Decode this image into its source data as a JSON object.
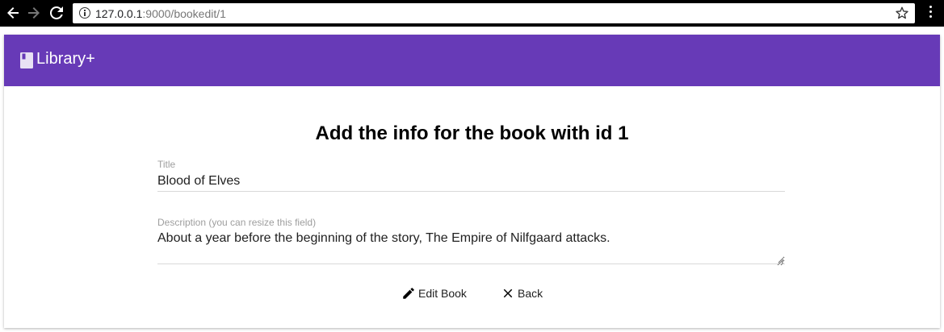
{
  "browser": {
    "url_host": "127.0.0.1",
    "url_rest": ":9000/bookedit/1",
    "icons": [
      "back-arrow-icon",
      "forward-arrow-icon",
      "reload-icon",
      "info-icon",
      "star-icon",
      "kebab-menu-icon"
    ]
  },
  "app": {
    "brand": "Library+",
    "brand_icon": "book-icon",
    "header_color": "#673ab7"
  },
  "form": {
    "heading": "Add the info for the book with id 1",
    "title_label": "Title",
    "title_value": "Blood of Elves",
    "description_label": "Description (you can resize this field)",
    "description_value": "About a year before the beginning of the story, The Empire of Nilfgaard attacks."
  },
  "actions": {
    "edit_label": "Edit Book",
    "edit_icon": "pencil-icon",
    "back_label": "Back",
    "back_icon": "close-icon"
  }
}
